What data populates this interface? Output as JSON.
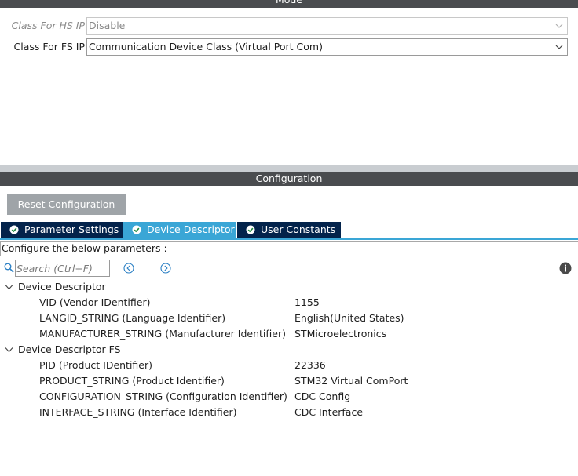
{
  "mode": {
    "header": "Mode",
    "rows": [
      {
        "label": "Class For HS IP",
        "value": "Disable",
        "disabled": true
      },
      {
        "label": "Class For FS IP",
        "value": "Communication Device Class (Virtual Port Com)",
        "disabled": false
      }
    ]
  },
  "configuration": {
    "header": "Configuration",
    "reset_label": "Reset Configuration",
    "tabs": [
      {
        "label": "Parameter Settings",
        "active": false
      },
      {
        "label": "Device Descriptor",
        "active": true
      },
      {
        "label": "User Constants",
        "active": false
      }
    ],
    "configure_text": "Configure the below parameters :",
    "search_placeholder": "Search (Ctrl+F)",
    "groups": [
      {
        "title": "Device Descriptor",
        "params": [
          {
            "name": "VID (Vendor IDentifier)",
            "value": "1155"
          },
          {
            "name": "LANGID_STRING (Language Identifier)",
            "value": "English(United States)"
          },
          {
            "name": "MANUFACTURER_STRING (Manufacturer Identifier)",
            "value": "STMicroelectronics"
          }
        ]
      },
      {
        "title": "Device Descriptor FS",
        "params": [
          {
            "name": "PID (Product IDentifier)",
            "value": "22336"
          },
          {
            "name": "PRODUCT_STRING (Product Identifier)",
            "value": "STM32 Virtual ComPort"
          },
          {
            "name": "CONFIGURATION_STRING (Configuration Identifier)",
            "value": "CDC Config"
          },
          {
            "name": "INTERFACE_STRING (Interface Identifier)",
            "value": "CDC Interface"
          }
        ]
      }
    ]
  },
  "colors": {
    "header_bg": "#4a4c4f",
    "tab_dark": "#03234b",
    "tab_active": "#3aa6d6",
    "reset_button": "#9fa4a8"
  }
}
